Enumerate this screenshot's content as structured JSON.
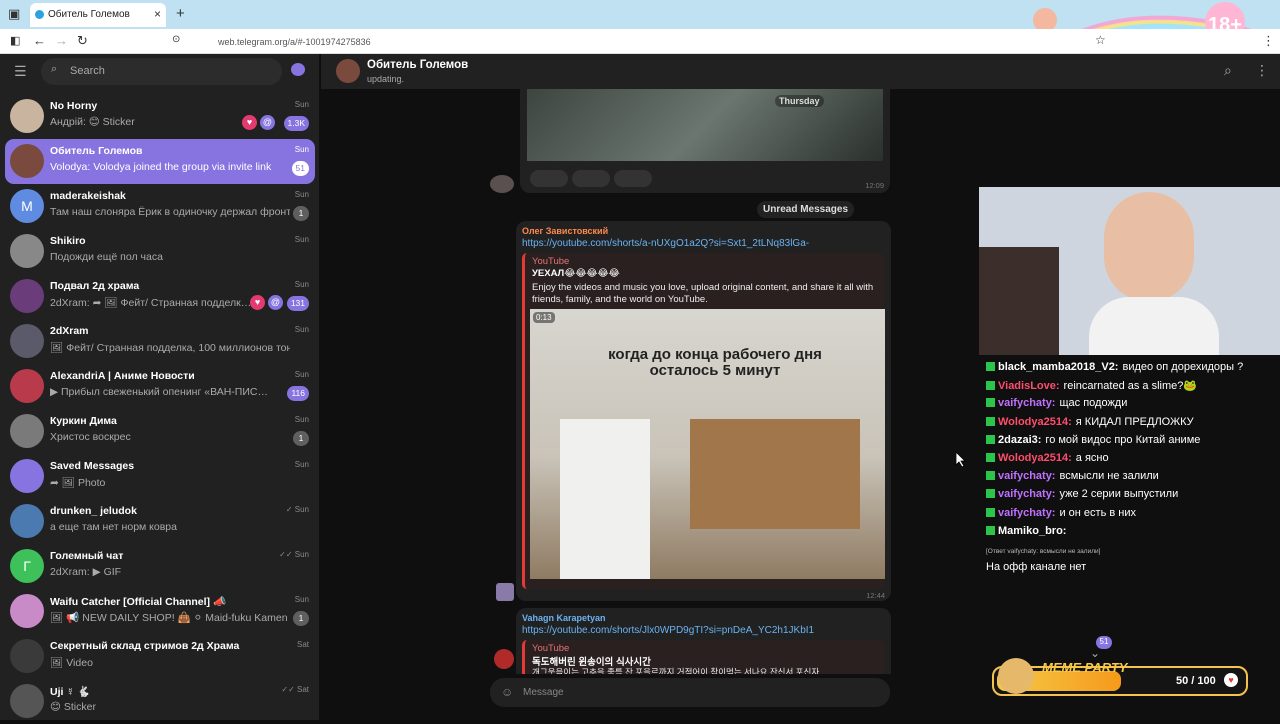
{
  "browser": {
    "tab_title": "Обитель Големов",
    "url": "web.telegram.org/a/#-1001974275836"
  },
  "sidebar": {
    "search_placeholder": "Search",
    "chats": [
      {
        "name": "No Horny",
        "msg": "Андрій: 😊 Sticker",
        "time": "Sun",
        "badge": "1.3K",
        "muted": false,
        "avatar_color": "#c9b4a0"
      },
      {
        "name": "Обитель Големов",
        "msg": "Volodya: Volodya joined the group via invite link",
        "time": "Sun",
        "badge": "51",
        "active": true,
        "avatar_color": "#7a4a3e"
      },
      {
        "name": "maderakeishak",
        "msg": "Там наш слоняра Ёрик в одиночку держал фронт…",
        "time": "Sun",
        "badge": "1",
        "avatar_letter": "M",
        "avatar_color": "#5f8ce0"
      },
      {
        "name": "Shikiro",
        "msg": "Подожди ещё пол часа",
        "time": "Sun",
        "badge": "",
        "avatar_color": "#888"
      },
      {
        "name": "Подвал 2д храма",
        "msg": "2dXram: ➦ 🖼 Фейт/ Странная подделк…",
        "time": "Sun",
        "badge": "131",
        "avatar_color": "#6a3d7a"
      },
      {
        "name": "2dXram",
        "msg": "🖼 Фейт/ Странная подделка, 100 миллионов тон гр…",
        "time": "Sun",
        "badge": "",
        "avatar_color": "#5a5a6a"
      },
      {
        "name": "AlexandriA | Аниме Новости",
        "msg": "▶ Прибыл свеженький опенинг «ВАН-ПИС…",
        "time": "Sun",
        "badge": "116",
        "avatar_color": "#b93a4a"
      },
      {
        "name": "Куркин Дима",
        "msg": "Христос воскрес",
        "time": "Sun",
        "badge": "1",
        "avatar_color": "#7a7a7a"
      },
      {
        "name": "Saved Messages",
        "msg": "➦ 🖼 Photo",
        "time": "Sun",
        "badge": "",
        "avatar_color": "#8774e1"
      },
      {
        "name": "drunken_ jeludok",
        "msg": "а еще там нет норм ковра",
        "time": "✓ Sun",
        "badge": "",
        "avatar_color": "#4a7ab0"
      },
      {
        "name": "Големный чат",
        "msg": "2dXram: ▶ GIF",
        "time": "✓✓ Sun",
        "badge": "",
        "avatar_letter": "Г",
        "avatar_color": "#3ec05a"
      },
      {
        "name": "Waifu Catcher [Official Channel] 📣",
        "msg": "🖼 📢 NEW DAILY SHOP! 👜 ⚪ Maid-fuku Kamen 🟣…",
        "time": "Sun",
        "badge": "1",
        "avatar_color": "#c98ac8"
      },
      {
        "name": "Секретный склад стримов 2д Храма",
        "msg": "🖼 Video",
        "time": "Sat",
        "badge": "",
        "avatar_color": "#3a3a3a"
      },
      {
        "name": "Uji ☿ 🐇",
        "msg": "😊 Sticker",
        "time": "✓✓ Sat",
        "badge": "",
        "avatar_color": "#555"
      }
    ]
  },
  "chat": {
    "title": "Обитель Големов",
    "status": "updating.",
    "photo_label": "Thursday",
    "time1": "12:09",
    "unread_label": "Unread Messages",
    "msg1": {
      "sender": "Олег Завистовский",
      "link": "https://youtube.com/shorts/a-nUXgO1a2Q?si=Sxt1_2tLNq83lGa-",
      "site": "YouTube",
      "title": "УЕХАЛ😂😂😂😂😂",
      "desc": "Enjoy the videos and music you love, upload original content, and share it all with friends, family, and the world on YouTube.",
      "duration": "0:13",
      "video_caption": "когда до конца рабочего дня осталось 5 минут",
      "time": "12:44"
    },
    "msg2": {
      "sender": "Vahagn Karapetyan",
      "link": "https://youtube.com/shorts/Jlx0WPD9gTI?si=pnDeA_YC2h1JKbI1",
      "site": "YouTube",
      "title": "독도해버린 윈송이의 식사시간",
      "desc": "개그웃음이는 고추을 좋를 잔 포을르까지 거적어이 참이먹는 서나요 잔신서 포신자"
    },
    "unread_count": "51",
    "composer_placeholder": "Message"
  },
  "stream_chat": [
    {
      "user": "black_mamba2018_V2:",
      "text": "видео оп дорехидоры ?",
      "color": "#ffffff"
    },
    {
      "user": "ViadisLove:",
      "text": "reincarnated as a slime?🐸",
      "color": "#ff4d6d"
    },
    {
      "user": "vaifychaty:",
      "text": "щас подожди",
      "color": "#c070ff"
    },
    {
      "user": "Wolodya2514:",
      "text": "я КИДАЛ ПРЕДЛОЖКУ",
      "color": "#ff4d6d"
    },
    {
      "user": "2dazai3:",
      "text": "го мой видос про Китай аниме",
      "color": "#ffffff"
    },
    {
      "user": "Wolodya2514:",
      "text": "а ясно",
      "color": "#ff4d6d"
    },
    {
      "user": "vaifychaty:",
      "text": "всмысли не залили",
      "color": "#c070ff"
    },
    {
      "user": "vaifychaty:",
      "text": "уже 2 серии выпустили",
      "color": "#c070ff"
    },
    {
      "user": "vaifychaty:",
      "text": "и он есть в них",
      "color": "#c070ff"
    },
    {
      "user": "Mamiko_bro:",
      "text": "",
      "color": "#ffffff"
    }
  ],
  "stream_reply": "[Ответ vaifychaty: всмысли не залили]",
  "stream_last": "На офф канале нет",
  "meme": {
    "title": "MEME PARTY",
    "progress": "50 / 100",
    "fraction": 0.5
  },
  "deco_badge": "18+"
}
